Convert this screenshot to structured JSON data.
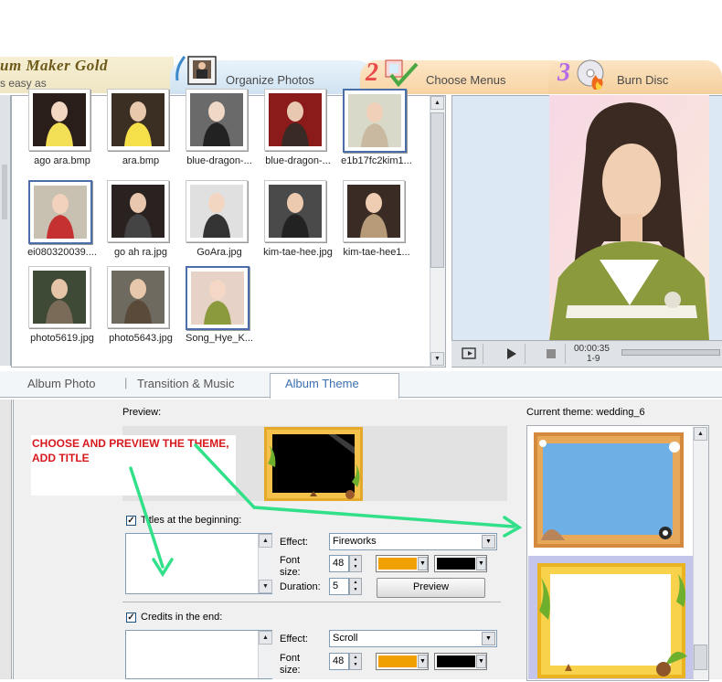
{
  "header": {
    "app_title": "um Maker Gold",
    "tagline": "s easy as"
  },
  "steps": [
    {
      "num": "",
      "label": "Organize Photos"
    },
    {
      "num": "2",
      "label": "Choose Menus"
    },
    {
      "num": "3",
      "label": "Burn Disc"
    }
  ],
  "thumbnails": [
    {
      "caption": "ago ara.bmp",
      "selected": false
    },
    {
      "caption": "ara.bmp",
      "selected": false
    },
    {
      "caption": "blue-dragon-...",
      "selected": false
    },
    {
      "caption": "blue-dragon-...",
      "selected": false
    },
    {
      "caption": "e1b17fc2kim1...",
      "selected": true
    },
    {
      "caption": "ei080320039....",
      "selected": true
    },
    {
      "caption": "go ah ra.jpg",
      "selected": false
    },
    {
      "caption": "GoAra.jpg",
      "selected": false
    },
    {
      "caption": "kim-tae-hee.jpg",
      "selected": false
    },
    {
      "caption": "kim-tae-hee1...",
      "selected": false
    },
    {
      "caption": "photo5619.jpg",
      "selected": false
    },
    {
      "caption": "photo5643.jpg",
      "selected": false
    },
    {
      "caption": "Song_Hye_K...",
      "selected": true
    }
  ],
  "player": {
    "time": "00:00:35",
    "frame": "1-9"
  },
  "lower_tabs": [
    "Album Photo",
    "Transition & Music",
    "Album Theme"
  ],
  "theme_panel": {
    "preview_label": "Preview:",
    "current_theme_label": "Current theme: wedding_6",
    "annotation": "CHOOSE AND PREVIEW THE THEME, ADD TITLE",
    "titles_checkbox": "Titles at the beginning:",
    "credits_checkbox": "Credits in the end:",
    "effect_label": "Effect:",
    "font_size_label": "Font\nsize:",
    "duration_label": "Duration:",
    "titles_effect": "Fireworks",
    "titles_font_size": "48",
    "titles_duration": "5",
    "preview_button": "Preview",
    "credits_effect": "Scroll",
    "credits_font_size": "48"
  },
  "colors": {
    "font_color": "#f0a000",
    "bg_color": "#000000",
    "annotation_color": "#d7181c",
    "arrow_color": "#33e08a"
  }
}
